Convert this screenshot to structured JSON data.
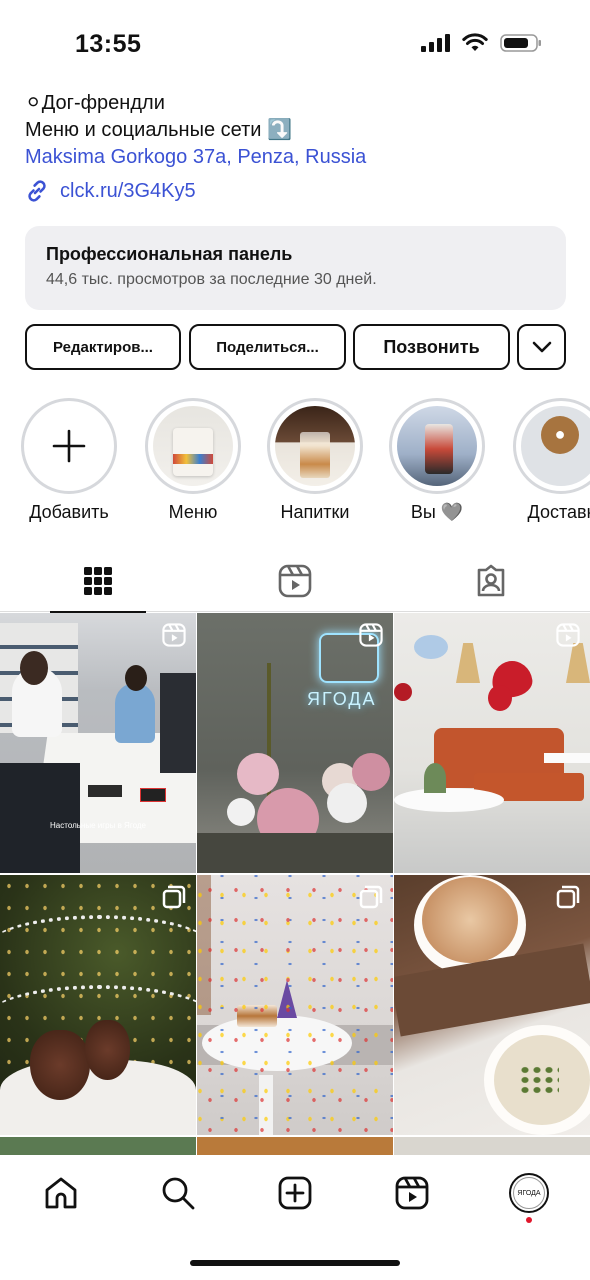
{
  "status_bar": {
    "time": "13:55"
  },
  "bio": {
    "line1": "⚪Дог-френдли",
    "line2": "Меню и социальные сети ⤵️",
    "address": "Maksima Gorkogo 37a, Penza, Russia",
    "link": "clck.ru/3G4Ky5"
  },
  "pro_panel": {
    "title": "Профессиональная панель",
    "subtitle": "44,6 тыс. просмотров за последние 30 дней."
  },
  "actions": {
    "edit": "Редактиров...",
    "share": "Поделиться...",
    "call": "Позвонить"
  },
  "highlights": [
    {
      "label": "Добавить"
    },
    {
      "label": "Меню"
    },
    {
      "label": "Напитки"
    },
    {
      "label": "Вы 🩶"
    },
    {
      "label": "Доставк"
    }
  ],
  "tabs": [
    "grid-icon",
    "reels-icon",
    "tagged-icon"
  ],
  "posts": [
    {
      "type": "reel",
      "caption": "Настольные игры в Ягоде"
    },
    {
      "type": "reel",
      "neon": "ЯГОДА"
    },
    {
      "type": "reel"
    },
    {
      "type": "carousel"
    },
    {
      "type": "carousel"
    },
    {
      "type": "carousel"
    }
  ],
  "nav": {
    "avatar_text": "ЯГОДА"
  },
  "colors": {
    "link": "#3b52d4",
    "panel_bg": "#efeff2",
    "notification_dot": "#e0162b"
  }
}
